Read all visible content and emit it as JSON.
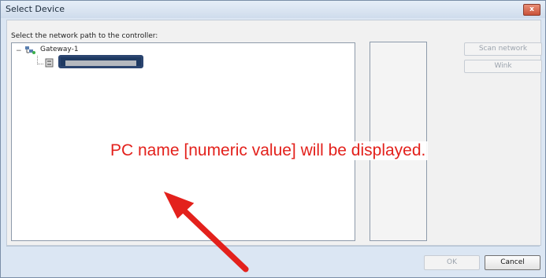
{
  "window": {
    "title": "Select Device",
    "close_symbol": "x"
  },
  "dialog": {
    "prompt": "Select the network path to the controller:",
    "tree": {
      "root": {
        "expander": "−",
        "icon": "network-gateway-icon",
        "label": "Gateway-1"
      },
      "child": {
        "icon": "controller-device-icon",
        "label_redacted": true
      }
    },
    "buttons": {
      "scan": "Scan network",
      "wink": "Wink",
      "ok": "OK",
      "cancel": "Cancel"
    }
  },
  "annotation": {
    "text": "PC name [numeric value] will be displayed.",
    "color": "#e3211c",
    "highlight_color": "#1f3a62"
  }
}
